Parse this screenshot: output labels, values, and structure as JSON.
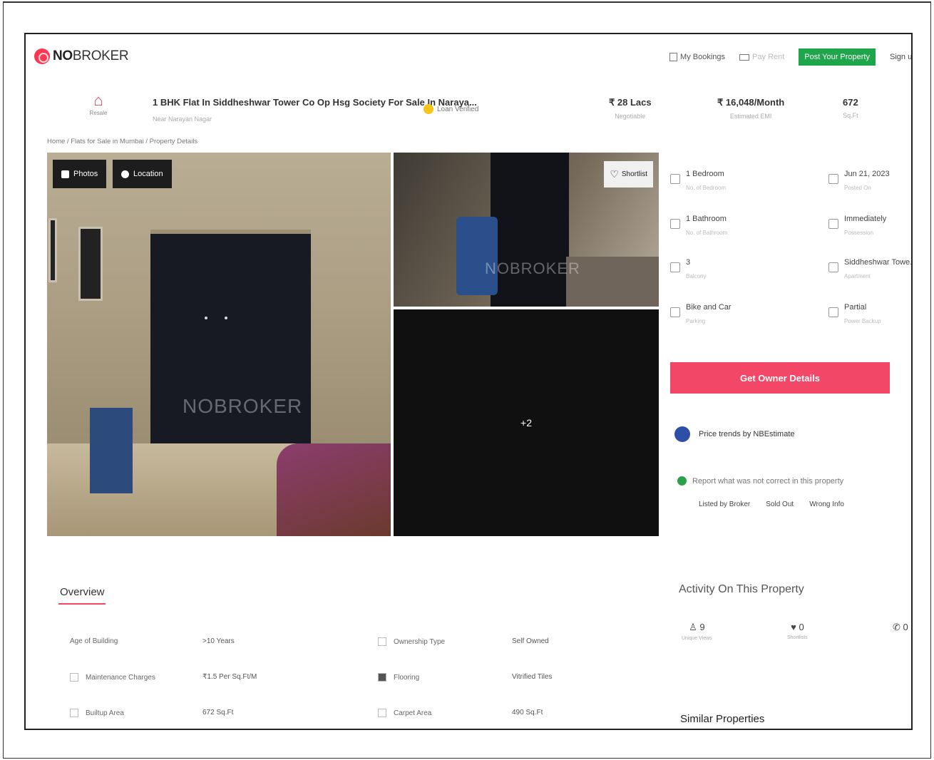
{
  "header": {
    "logo_bold": "NO",
    "logo_rest": "BROKER",
    "nav": {
      "bookings": "My Bookings",
      "pay_rent": "Pay Rent",
      "post_property": "Post Your Property",
      "signup": "Sign up"
    }
  },
  "property": {
    "icon_label": "Resale",
    "title": "1 BHK Flat In Siddheshwar Tower Co Op Hsg Society For Sale In Naraya...",
    "subtitle": "Near Narayan Nagar",
    "verified": "Loan Verified",
    "price": "₹ 28 Lacs",
    "price_sub": "Negotiable",
    "emi": "₹ 16,048/Month",
    "emi_sub": "Estimated EMI",
    "area": "672",
    "area_sub": "Sq.Ft"
  },
  "breadcrumb": "Home / Flats for Sale in Mumbai / Property Details",
  "gallery": {
    "photos_label": "Photos",
    "location_label": "Location",
    "shortlist_label": "Shortlist",
    "more_count": "+2",
    "watermark": "NOBROKER"
  },
  "facts": [
    {
      "value": "1 Bedroom",
      "sub": "No. of Bedroom"
    },
    {
      "value": "Jun 21, 2023",
      "sub": "Posted On"
    },
    {
      "value": "1 Bathroom",
      "sub": "No. of Bathroom"
    },
    {
      "value": "Immediately",
      "sub": "Possession"
    },
    {
      "value": "3",
      "sub": "Balcony"
    },
    {
      "value": "Siddheshwar Towe...",
      "sub": "Apartment"
    },
    {
      "value": "Bike and Car",
      "sub": "Parking"
    },
    {
      "value": "Partial",
      "sub": "Power Backup"
    }
  ],
  "actions": {
    "owner_details": "Get Owner Details",
    "price_trends": "Price trends by NBEstimate",
    "report_text": "Report what was not correct in this property",
    "report_options": [
      "Listed by Broker",
      "Sold Out",
      "Wrong Info"
    ]
  },
  "overview": {
    "title": "Overview",
    "rows": [
      {
        "label": "Age of Building",
        "value": ">10 Years"
      },
      {
        "label": "Ownership Type",
        "value": "Self Owned"
      },
      {
        "label": "Maintenance Charges",
        "value": "₹1.5 Per Sq.Ft/M"
      },
      {
        "label": "Flooring",
        "value": "Vitrified Tiles"
      },
      {
        "label": "Builtup Area",
        "value": "672 Sq.Ft"
      },
      {
        "label": "Carpet Area",
        "value": "490 Sq.Ft"
      }
    ]
  },
  "activity": {
    "title": "Activity On This Property",
    "views": "9",
    "views_sub": "Unique Views",
    "shortlists": "0",
    "shortlists_sub": "Shortlists",
    "contacts": "0"
  },
  "similar_title": "Similar Properties",
  "colors": {
    "brand": "#fd3752",
    "post_button": "#1fa64a",
    "owner_button": "#f24767"
  }
}
